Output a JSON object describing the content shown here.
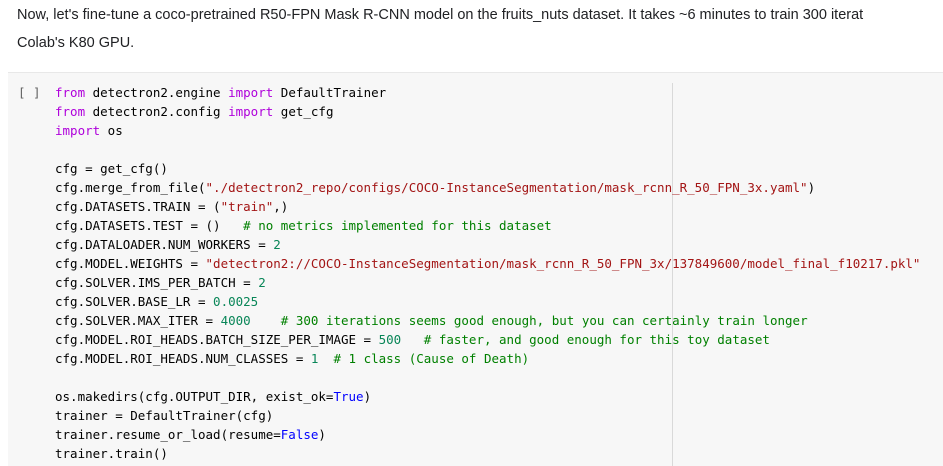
{
  "description": {
    "lines": [
      "Now, let's fine-tune a coco-pretrained R50-FPN Mask R-CNN model on the fruits_nuts dataset. It takes ~6 minutes to train 300 iterat",
      "Colab's K80 GPU."
    ]
  },
  "code_cell": {
    "run_indicator": "[ ]",
    "lines": [
      [
        {
          "t": "kw",
          "v": "from"
        },
        {
          "t": "plain",
          "v": " detectron2.engine "
        },
        {
          "t": "kw",
          "v": "import"
        },
        {
          "t": "plain",
          "v": " DefaultTrainer"
        }
      ],
      [
        {
          "t": "kw",
          "v": "from"
        },
        {
          "t": "plain",
          "v": " detectron2.config "
        },
        {
          "t": "kw",
          "v": "import"
        },
        {
          "t": "plain",
          "v": " get_cfg"
        }
      ],
      [
        {
          "t": "kw",
          "v": "import"
        },
        {
          "t": "plain",
          "v": " os"
        }
      ],
      [],
      [
        {
          "t": "plain",
          "v": "cfg = get_cfg()"
        }
      ],
      [
        {
          "t": "plain",
          "v": "cfg.merge_from_file("
        },
        {
          "t": "str",
          "v": "\"./detectron2_repo/configs/COCO-InstanceSegmentation/mask_rcnn_R_50_FPN_3x.yaml\""
        },
        {
          "t": "plain",
          "v": ")"
        }
      ],
      [
        {
          "t": "plain",
          "v": "cfg.DATASETS.TRAIN = ("
        },
        {
          "t": "str",
          "v": "\"train\""
        },
        {
          "t": "plain",
          "v": ",)"
        }
      ],
      [
        {
          "t": "plain",
          "v": "cfg.DATASETS.TEST = ()   "
        },
        {
          "t": "cm",
          "v": "# no metrics implemented for this dataset"
        }
      ],
      [
        {
          "t": "plain",
          "v": "cfg.DATALOADER.NUM_WORKERS = "
        },
        {
          "t": "num",
          "v": "2"
        }
      ],
      [
        {
          "t": "plain",
          "v": "cfg.MODEL.WEIGHTS = "
        },
        {
          "t": "str",
          "v": "\"detectron2://COCO-InstanceSegmentation/mask_rcnn_R_50_FPN_3x/137849600/model_final_f10217.pkl\""
        }
      ],
      [
        {
          "t": "plain",
          "v": "cfg.SOLVER.IMS_PER_BATCH = "
        },
        {
          "t": "num",
          "v": "2"
        }
      ],
      [
        {
          "t": "plain",
          "v": "cfg.SOLVER.BASE_LR = "
        },
        {
          "t": "num",
          "v": "0.0025"
        }
      ],
      [
        {
          "t": "plain",
          "v": "cfg.SOLVER.MAX_ITER = "
        },
        {
          "t": "num",
          "v": "4000"
        },
        {
          "t": "plain",
          "v": "    "
        },
        {
          "t": "cm",
          "v": "# 300 iterations seems good enough, but you can certainly train longer"
        }
      ],
      [
        {
          "t": "plain",
          "v": "cfg.MODEL.ROI_HEADS.BATCH_SIZE_PER_IMAGE = "
        },
        {
          "t": "num",
          "v": "500"
        },
        {
          "t": "plain",
          "v": "   "
        },
        {
          "t": "cm",
          "v": "# faster, and good enough for this toy dataset"
        }
      ],
      [
        {
          "t": "plain",
          "v": "cfg.MODEL.ROI_HEADS.NUM_CLASSES = "
        },
        {
          "t": "num",
          "v": "1"
        },
        {
          "t": "plain",
          "v": "  "
        },
        {
          "t": "cm",
          "v": "# 1 class (Cause of Death)"
        }
      ],
      [],
      [
        {
          "t": "plain",
          "v": "os.makedirs(cfg.OUTPUT_DIR, exist_ok="
        },
        {
          "t": "const",
          "v": "True"
        },
        {
          "t": "plain",
          "v": ")"
        }
      ],
      [
        {
          "t": "plain",
          "v": "trainer = DefaultTrainer(cfg)"
        }
      ],
      [
        {
          "t": "plain",
          "v": "trainer.resume_or_load(resume="
        },
        {
          "t": "const",
          "v": "False"
        },
        {
          "t": "plain",
          "v": ")"
        }
      ],
      [
        {
          "t": "plain",
          "v": "trainer.train()"
        }
      ]
    ]
  },
  "colors": {
    "keyword": "#af00db",
    "string": "#a31515",
    "number": "#098658",
    "comment": "#008000",
    "constant": "#0000ff",
    "cell_background": "#f7f7f7"
  }
}
